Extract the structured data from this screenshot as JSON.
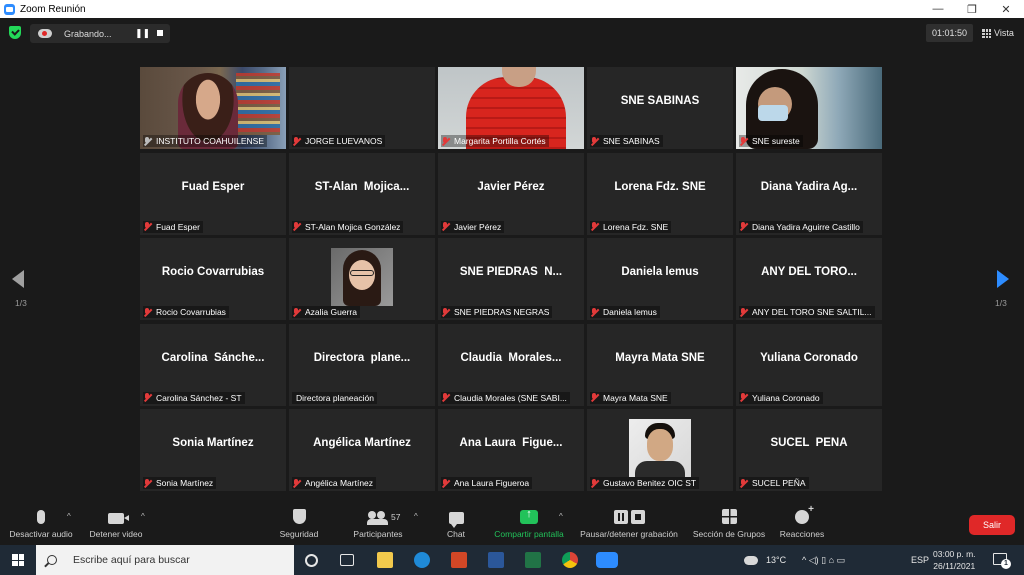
{
  "window": {
    "title": "Zoom Reunión",
    "minimize": "—",
    "restore": "❐",
    "close": "✕"
  },
  "topbar": {
    "recording_label": "Grabando...",
    "pause_glyph": "❚❚",
    "timer": "01:01:50",
    "view_label": "Vista"
  },
  "gallery": {
    "page_indicator_left": "1/3",
    "page_indicator_right": "1/3",
    "tiles": [
      {
        "display": "",
        "label": "INSTITUTO COAHUILENSE",
        "media": "video-instituto",
        "muted": false,
        "active": true
      },
      {
        "display": "",
        "label": "JORGE LUEVANOS",
        "media": "none",
        "muted": true
      },
      {
        "display": "",
        "label": "Margarita Portilla Cortés",
        "media": "video-margarita",
        "muted": true
      },
      {
        "display": "SNE SABINAS",
        "label": "SNE SABINAS",
        "media": "none",
        "muted": true
      },
      {
        "display": "",
        "label": "SNE sureste",
        "media": "video-sureste",
        "muted": true
      },
      {
        "display": "Fuad Esper",
        "label": "Fuad Esper",
        "media": "none",
        "muted": true
      },
      {
        "display": "ST-Alan  Mojica...",
        "label": "ST-Alan Mojica González",
        "media": "none",
        "muted": true
      },
      {
        "display": "Javier Pérez",
        "label": "Javier Pérez",
        "media": "none",
        "muted": true
      },
      {
        "display": "Lorena Fdz. SNE",
        "label": "Lorena Fdz. SNE",
        "media": "none",
        "muted": true
      },
      {
        "display": "Diana Yadira Ag...",
        "label": "Diana Yadira Aguirre Castillo",
        "media": "none",
        "muted": true
      },
      {
        "display": "Rocio Covarrubias",
        "label": "Rocio Covarrubias",
        "media": "none",
        "muted": true
      },
      {
        "display": "",
        "label": "Azalia Guerra",
        "media": "photo-azalia",
        "muted": true
      },
      {
        "display": "SNE PIEDRAS  N...",
        "label": "SNE PIEDRAS NEGRAS",
        "media": "none",
        "muted": true
      },
      {
        "display": "Daniela lemus",
        "label": "Daniela lemus",
        "media": "none",
        "muted": true
      },
      {
        "display": "ANY DEL TORO...",
        "label": "ANY DEL TORO SNE SALTIL...",
        "media": "none",
        "muted": true
      },
      {
        "display": "Carolina  Sánche...",
        "label": "Carolina Sánchez - ST",
        "media": "none",
        "muted": true
      },
      {
        "display": "Directora  plane...",
        "label": "Directora planeación",
        "media": "none",
        "muted": false
      },
      {
        "display": "Claudia  Morales...",
        "label": "Claudia Morales (SNE SABI...",
        "media": "none",
        "muted": true
      },
      {
        "display": "Mayra Mata SNE",
        "label": "Mayra Mata SNE",
        "media": "none",
        "muted": true
      },
      {
        "display": "Yuliana Coronado",
        "label": "Yuliana Coronado",
        "media": "none",
        "muted": true
      },
      {
        "display": "Sonia Martínez",
        "label": "Sonia Martínez",
        "media": "none",
        "muted": true
      },
      {
        "display": "Angélica Martínez",
        "label": "Angélica Martínez",
        "media": "none",
        "muted": true
      },
      {
        "display": "Ana Laura  Figue...",
        "label": "Ana Laura Figueroa",
        "media": "none",
        "muted": true
      },
      {
        "display": "",
        "label": "Gustavo Benitez OIC ST",
        "media": "photo-gustavo",
        "muted": true
      },
      {
        "display": "SUCEL  PEÑA",
        "label": "SUCEL  PEÑA",
        "media": "none",
        "muted": true
      }
    ]
  },
  "controls": {
    "mute": "Desactivar audio",
    "video": "Detener video",
    "security": "Seguridad",
    "participants": "Participantes",
    "participants_count": "57",
    "chat": "Chat",
    "share": "Compartir pantalla",
    "record": "Pausar/detener grabación",
    "rooms": "Sección de Grupos",
    "reactions": "Reacciones",
    "caret": "^",
    "leave": "Salir"
  },
  "taskbar": {
    "search_placeholder": "Escribe aquí para buscar",
    "temperature": "13°C",
    "tray_glyphs": "^  ◁)  ▯  ⌂  ▭",
    "language": "ESP",
    "time": "03:00 p. m.",
    "date": "26/11/2021",
    "notifications": "1"
  },
  "colors": {
    "accent": "#2d8cff",
    "active_speaker": "#e5e84a",
    "leave": "#e02828",
    "muted_mic": "#e23a3a",
    "share": "#22c25a"
  }
}
